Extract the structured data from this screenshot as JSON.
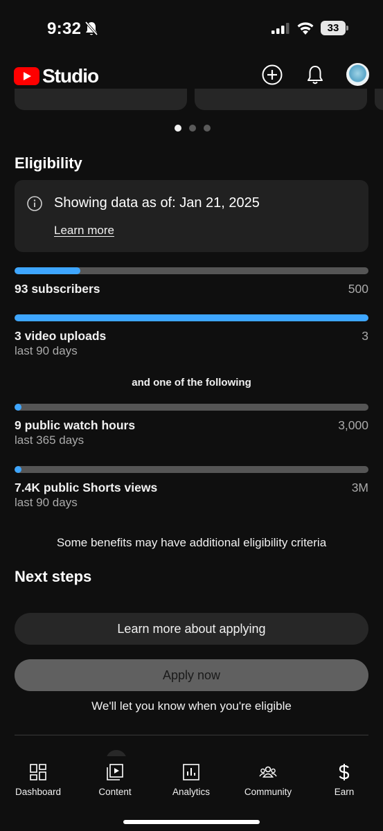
{
  "status_bar": {
    "time": "9:32",
    "battery": "33"
  },
  "header": {
    "logo_text": "Studio"
  },
  "carousel": {
    "dot_count": 3,
    "active_index": 0
  },
  "eligibility": {
    "title": "Eligibility",
    "info_text": "Showing data as of: Jan 21, 2025",
    "learn_more": "Learn more"
  },
  "metrics": [
    {
      "label": "93 subscribers",
      "sub": "",
      "goal": "500",
      "progress": 0.186
    },
    {
      "label": "3 video uploads",
      "sub": "last 90 days",
      "goal": "3",
      "progress": 1.0
    },
    {
      "label": "9 public watch hours",
      "sub": "last 365 days",
      "goal": "3,000",
      "progress": 0.003
    },
    {
      "label": "7.4K public Shorts views",
      "sub": "last 90 days",
      "goal": "3M",
      "progress": 0.0025
    }
  ],
  "and_following": "and one of the following",
  "benefits_note": "Some benefits may have additional eligibility criteria",
  "next_steps": {
    "title": "Next steps",
    "learn_button": "Learn more about applying",
    "apply_button": "Apply now",
    "eligible_note": "We'll let you know when you're eligible"
  },
  "nav": {
    "items": [
      {
        "label": "Dashboard",
        "icon": "dashboard-icon"
      },
      {
        "label": "Content",
        "icon": "content-icon"
      },
      {
        "label": "Analytics",
        "icon": "analytics-icon"
      },
      {
        "label": "Community",
        "icon": "community-icon"
      },
      {
        "label": "Earn",
        "icon": "earn-icon"
      }
    ]
  },
  "colors": {
    "accent": "#3ea6ff",
    "brand": "#ff0000",
    "background": "#0f0f0f"
  }
}
